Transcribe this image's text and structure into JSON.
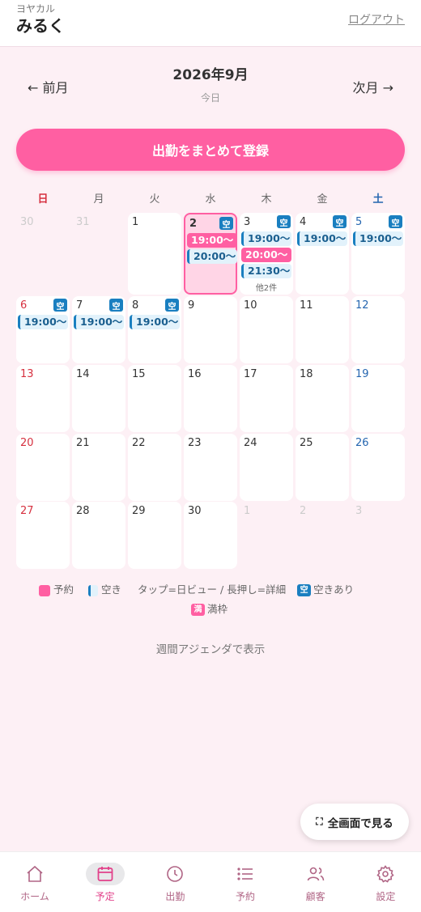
{
  "header": {
    "subtitle": "ヨヤカル",
    "name": "みるく",
    "logout": "ログアウト"
  },
  "month_nav": {
    "prev": "← 前月",
    "title": "2026年9月",
    "today": "今日",
    "next": "次月 →"
  },
  "main_button": "出勤をまとめて登録",
  "weekdays": [
    "日",
    "月",
    "火",
    "水",
    "木",
    "金",
    "土"
  ],
  "calendar": [
    {
      "day": "30",
      "faded": true,
      "badge": "",
      "chips": [],
      "more": ""
    },
    {
      "day": "31",
      "faded": true,
      "badge": "",
      "chips": [],
      "more": ""
    },
    {
      "day": "1",
      "badge": "",
      "chips": [],
      "more": ""
    },
    {
      "day": "2",
      "today": true,
      "badge": "空",
      "chips": [
        {
          "t": "19:00〜",
          "k": "resv"
        },
        {
          "t": "20:00〜",
          "k": "avail"
        }
      ],
      "more": ""
    },
    {
      "day": "3",
      "badge": "空",
      "chips": [
        {
          "t": "19:00〜",
          "k": "avail"
        },
        {
          "t": "20:00〜",
          "k": "resv"
        },
        {
          "t": "21:30〜",
          "k": "avail"
        }
      ],
      "more": "他2件"
    },
    {
      "day": "4",
      "badge": "空",
      "chips": [
        {
          "t": "19:00〜",
          "k": "avail"
        }
      ],
      "more": ""
    },
    {
      "day": "5",
      "badge": "空",
      "chips": [
        {
          "t": "19:00〜",
          "k": "avail"
        }
      ],
      "more": ""
    },
    {
      "day": "6",
      "badge": "空",
      "chips": [
        {
          "t": "19:00〜",
          "k": "avail"
        }
      ],
      "more": ""
    },
    {
      "day": "7",
      "badge": "空",
      "chips": [
        {
          "t": "19:00〜",
          "k": "avail"
        }
      ],
      "more": ""
    },
    {
      "day": "8",
      "badge": "空",
      "chips": [
        {
          "t": "19:00〜",
          "k": "avail"
        }
      ],
      "more": ""
    },
    {
      "day": "9",
      "badge": "",
      "chips": [],
      "more": ""
    },
    {
      "day": "10",
      "badge": "",
      "chips": [],
      "more": ""
    },
    {
      "day": "11",
      "badge": "",
      "chips": [],
      "more": ""
    },
    {
      "day": "12",
      "badge": "",
      "chips": [],
      "more": ""
    },
    {
      "day": "13",
      "badge": "",
      "chips": [],
      "more": ""
    },
    {
      "day": "14",
      "badge": "",
      "chips": [],
      "more": ""
    },
    {
      "day": "15",
      "badge": "",
      "chips": [],
      "more": ""
    },
    {
      "day": "16",
      "badge": "",
      "chips": [],
      "more": ""
    },
    {
      "day": "17",
      "badge": "",
      "chips": [],
      "more": ""
    },
    {
      "day": "18",
      "badge": "",
      "chips": [],
      "more": ""
    },
    {
      "day": "19",
      "badge": "",
      "chips": [],
      "more": ""
    },
    {
      "day": "20",
      "badge": "",
      "chips": [],
      "more": ""
    },
    {
      "day": "21",
      "badge": "",
      "chips": [],
      "more": ""
    },
    {
      "day": "22",
      "badge": "",
      "chips": [],
      "more": ""
    },
    {
      "day": "23",
      "badge": "",
      "chips": [],
      "more": ""
    },
    {
      "day": "24",
      "badge": "",
      "chips": [],
      "more": ""
    },
    {
      "day": "25",
      "badge": "",
      "chips": [],
      "more": ""
    },
    {
      "day": "26",
      "badge": "",
      "chips": [],
      "more": ""
    },
    {
      "day": "27",
      "badge": "",
      "chips": [],
      "more": ""
    },
    {
      "day": "28",
      "badge": "",
      "chips": [],
      "more": ""
    },
    {
      "day": "29",
      "badge": "",
      "chips": [],
      "more": ""
    },
    {
      "day": "30",
      "badge": "",
      "chips": [],
      "more": ""
    },
    {
      "day": "1",
      "faded": true,
      "badge": "",
      "chips": [],
      "more": ""
    },
    {
      "day": "2",
      "faded": true,
      "badge": "",
      "chips": [],
      "more": ""
    },
    {
      "day": "3",
      "faded": true,
      "badge": "",
      "chips": [],
      "more": ""
    }
  ],
  "legend": {
    "reserved": "予約",
    "available": "空き",
    "hint": "タップ=日ビュー / 長押し=詳細",
    "badge_avail": "空",
    "badge_avail_label": "空きあり",
    "badge_full": "満",
    "badge_full_label": "満枠"
  },
  "weekly_link": "週間アジェンダで表示",
  "fullscreen": "全画面で見る",
  "bottom_nav": [
    {
      "label": "ホーム",
      "icon": "home-icon"
    },
    {
      "label": "予定",
      "icon": "calendar-icon",
      "active": true
    },
    {
      "label": "出勤",
      "icon": "clock-icon"
    },
    {
      "label": "予約",
      "icon": "list-icon"
    },
    {
      "label": "顧客",
      "icon": "users-icon"
    },
    {
      "label": "設定",
      "icon": "gear-icon"
    }
  ]
}
